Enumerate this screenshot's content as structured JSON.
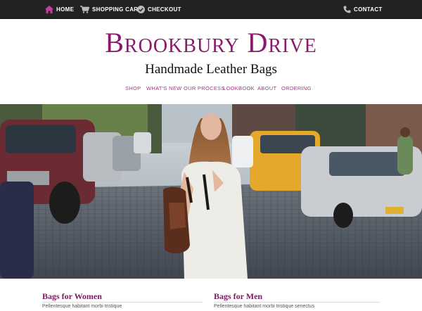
{
  "topnav": {
    "home": "HOME",
    "cart": "SHOPPING CART",
    "checkout": "CHECKOUT",
    "contact": "CONTACT"
  },
  "header": {
    "brand": "Brookbury Drive",
    "tagline": "Handmade Leather Bags"
  },
  "mainnav": {
    "items": [
      "SHOP",
      "WHAT'S NEW",
      "OUR PROCESS",
      "LOOKBOOK",
      "ABOUT",
      "ORDERING"
    ]
  },
  "sections": [
    {
      "title": "Bags for Women",
      "text": "Pellentesque habitant morbi tristique"
    },
    {
      "title": "Bags for Men",
      "text": "Pellentesque habitant morbi tristique senectus"
    }
  ],
  "colors": {
    "accent": "#8a1a6c",
    "nav_link": "#b0308c",
    "topbar": "#222222"
  },
  "icons": [
    "home-icon",
    "cart-icon",
    "checkmark-icon",
    "phone-icon"
  ]
}
